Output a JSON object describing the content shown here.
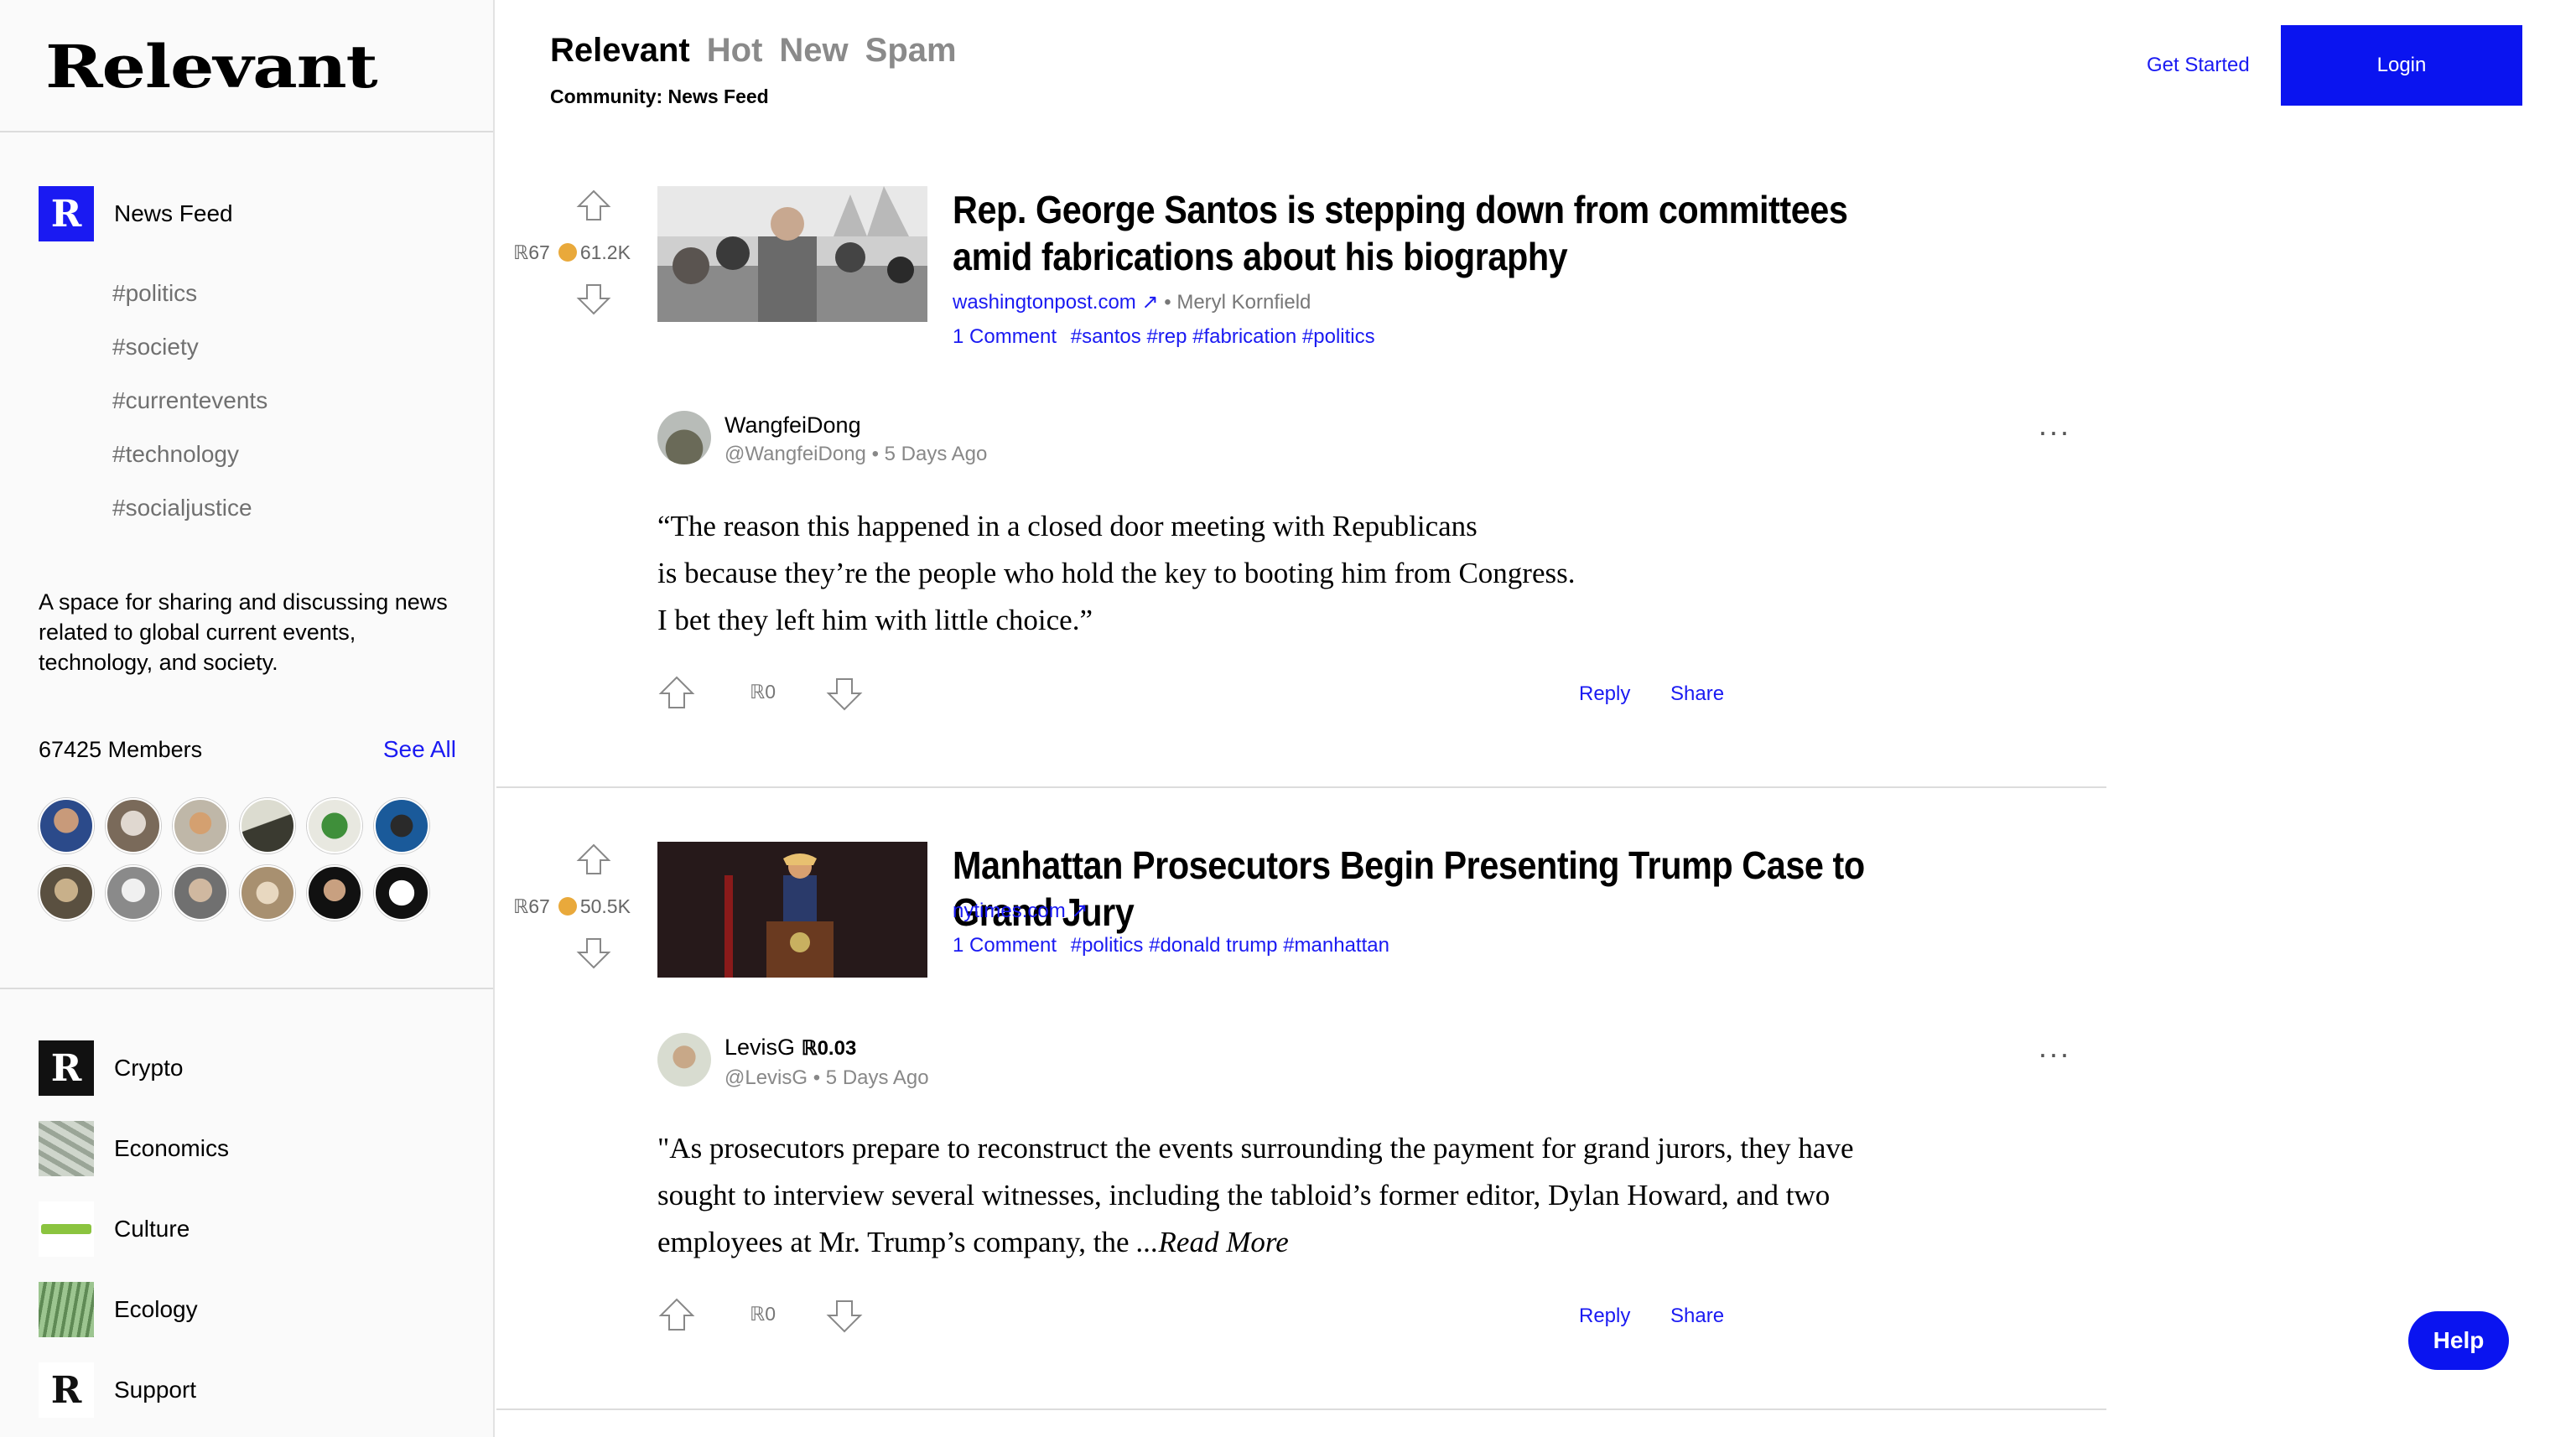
{
  "app": {
    "logo": "Relevant"
  },
  "sidebar": {
    "community": {
      "icon": "R",
      "label": "News Feed"
    },
    "tags": [
      "#politics",
      "#society",
      "#currentevents",
      "#technology",
      "#socialjustice"
    ],
    "about": "A space for sharing and discussing news related to global current events, technology, and society.",
    "members_count": "67425 Members",
    "see_all": "See All",
    "communities": [
      {
        "label": "Crypto",
        "icon": "crypto-logo-icon"
      },
      {
        "label": "Economics",
        "icon": "money-image-icon"
      },
      {
        "label": "Culture",
        "icon": "culture-logo-icon"
      },
      {
        "label": "Ecology",
        "icon": "nature-image-icon"
      },
      {
        "label": "Support",
        "icon": "support-logo-icon"
      }
    ]
  },
  "header": {
    "tabs": [
      "Relevant",
      "Hot",
      "New",
      "Spam"
    ],
    "active_tab": "Relevant",
    "community_line": "Community: News Feed",
    "get_started": "Get Started",
    "login": "Login"
  },
  "posts": [
    {
      "rank": "67",
      "coins": "61.2K",
      "title": "Rep. George Santos is stepping down from committees amid fabrications about his biography",
      "domain": "washingtonpost.com ↗",
      "author": "• Meryl Kornfield",
      "comments": "1 Comment",
      "tags": "#santos #rep #fabrication #politics",
      "comment": {
        "user": "WangfeiDong",
        "handle": "@WangfeiDong",
        "time": "• 5 Days Ago",
        "lines": [
          "“The reason this happened in a closed door meeting with Republicans",
          "is because they’re the people who hold the key to booting him from Congress.",
          "I bet they left him with little choice.”"
        ],
        "votes": "0",
        "reply": "Reply",
        "share": "Share"
      }
    },
    {
      "rank": "67",
      "coins": "50.5K",
      "title": "Manhattan Prosecutors Begin Presenting Trump Case to Grand Jury",
      "domain": "nytimes.com ↗",
      "comments": "1 Comment",
      "tags": "#politics #donald trump #manhattan",
      "comment": {
        "user": "LevisG",
        "user_score": "0.03",
        "handle": "@LevisG",
        "time": "• 5 Days Ago",
        "lines": [
          "\"As prosecutors prepare to reconstruct the events surrounding the payment for grand jurors, they have",
          "sought to interview several witnesses, including the tabloid’s former editor, Dylan Howard, and two",
          "employees at Mr. Trump’s company, the "
        ],
        "read_more": "...Read More",
        "votes": "0",
        "reply": "Reply",
        "share": "Share"
      }
    }
  ],
  "help": "Help"
}
